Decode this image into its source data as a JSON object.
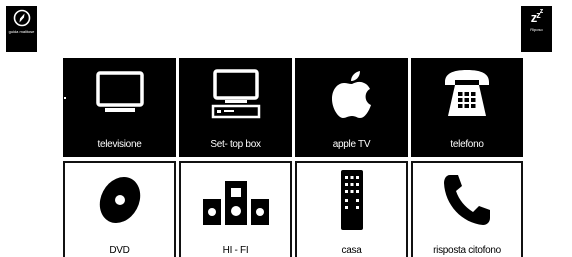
{
  "corner_left": {
    "icon": "compass-icon",
    "label": "guida malitose"
  },
  "corner_right": {
    "icon": "sleep-zzz-icon",
    "label": "Riposo",
    "glyph": "zzz"
  },
  "tiles_top": [
    {
      "icon": "television-icon",
      "label": "televisione"
    },
    {
      "icon": "set-top-box-icon",
      "label": "Set- top box"
    },
    {
      "icon": "apple-icon",
      "label": "apple TV"
    },
    {
      "icon": "telephone-icon",
      "label": "telefono"
    }
  ],
  "tiles_bottom": [
    {
      "icon": "dvd-disc-icon",
      "label": "DVD"
    },
    {
      "icon": "hifi-speakers-icon",
      "label": "HI - FI"
    },
    {
      "icon": "remote-control-icon",
      "label": "casa"
    },
    {
      "icon": "phone-handset-icon",
      "label": "risposta citofono"
    }
  ],
  "colors": {
    "tile_dark": "#000000",
    "tile_light": "#ffffff",
    "text_dark_tile": "#ffffff"
  }
}
